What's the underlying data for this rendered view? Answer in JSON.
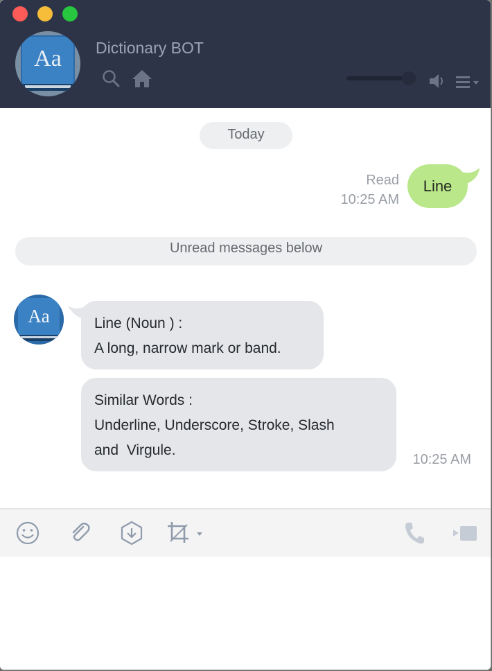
{
  "header": {
    "title": "Dictionary BOT",
    "avatar_text": "Aa",
    "icons": [
      "search-icon",
      "home-icon",
      "speaker-icon",
      "menu-icon"
    ],
    "volume_level": 0.83
  },
  "chat": {
    "date_divider": "Today",
    "outgoing": {
      "status": "Read",
      "time": "10:25 AM",
      "text": "Line"
    },
    "unread_divider": "Unread messages below",
    "incoming": [
      {
        "lines": [
          "Line (Noun ) :",
          "A long, narrow mark or band."
        ]
      },
      {
        "lines": [
          "Similar Words :",
          "Underline, Underscore, Stroke, Slash",
          "and  Virgule."
        ]
      }
    ],
    "incoming_time": "10:25 AM"
  },
  "toolbar": {
    "icons": [
      "emoji-icon",
      "attach-icon",
      "download-icon",
      "crop-icon",
      "call-icon",
      "video-call-icon"
    ]
  },
  "colors": {
    "header_bg": "#2d3447",
    "outgoing_bubble": "#b9e78a",
    "incoming_bubble": "#e4e6e9",
    "close": "#fc5b57",
    "minimize": "#f6bd3b",
    "maximize": "#27c840"
  }
}
